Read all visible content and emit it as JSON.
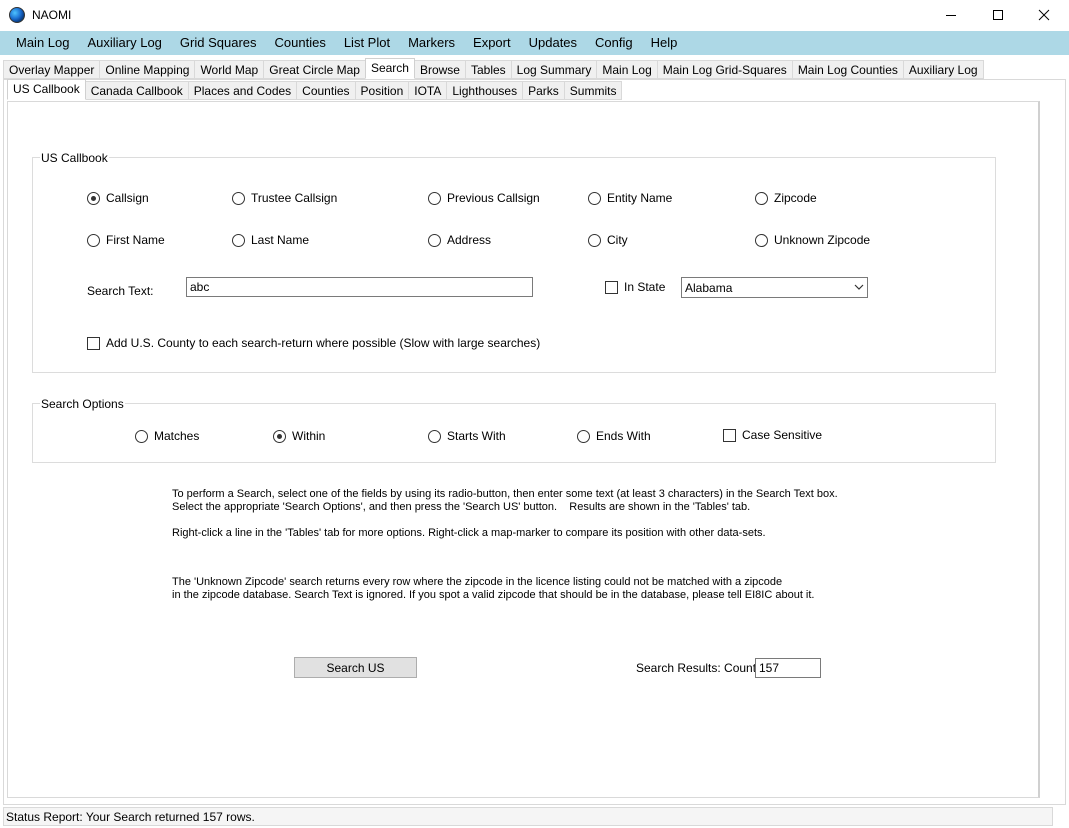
{
  "window": {
    "title": "NAOMI",
    "minimize_glyph": "—",
    "close_glyph": "✕"
  },
  "menu": [
    "Main Log",
    "Auxiliary Log",
    "Grid Squares",
    "Counties",
    "List Plot",
    "Markers",
    "Export",
    "Updates",
    "Config",
    "Help"
  ],
  "tabs_top": {
    "items": [
      "Overlay Mapper",
      "Online Mapping",
      "World Map",
      "Great Circle Map",
      "Search",
      "Browse",
      "Tables",
      "Log Summary",
      "Main Log",
      "Main Log Grid-Squares",
      "Main Log Counties",
      "Auxiliary Log"
    ],
    "active": "Search"
  },
  "tabs_sub": {
    "items": [
      "US Callbook",
      "Canada Callbook",
      "Places and Codes",
      "Counties",
      "Position",
      "IOTA",
      "Lighthouses",
      "Parks",
      "Summits"
    ],
    "active": "US Callbook"
  },
  "us_callbook": {
    "group_label": "US Callbook",
    "fields": {
      "callsign": "Callsign",
      "trustee_callsign": "Trustee Callsign",
      "previous_callsign": "Previous Callsign",
      "entity_name": "Entity Name",
      "zipcode": "Zipcode",
      "first_name": "First Name",
      "last_name": "Last Name",
      "address": "Address",
      "city": "City",
      "unknown_zipcode": "Unknown Zipcode"
    },
    "selected_field": "Callsign",
    "search_text_label": "Search Text:",
    "search_text_value": "abc",
    "in_state_label": "In State",
    "in_state_checked": false,
    "state_selected": "Alabama",
    "county_checkbox_label": "Add U.S. County to each search-return where possible (Slow with large searches)",
    "county_checked": false
  },
  "search_options": {
    "group_label": "Search Options",
    "matches": "Matches",
    "within": "Within",
    "starts_with": "Starts With",
    "ends_with": "Ends With",
    "selected": "Within",
    "case_sensitive_label": "Case Sensitive",
    "case_sensitive_checked": false
  },
  "instructions": {
    "line1": "To perform a Search, select one of the fields by using its radio-button, then enter some text (at least 3 characters) in the Search Text box.",
    "line2": "Select the appropriate 'Search Options', and then press the 'Search US' button.    Results are shown in the 'Tables' tab.",
    "line3": "Right-click a line in the 'Tables' tab for more options. Right-click a map-marker to compare its position with other data-sets.",
    "line4": "The 'Unknown Zipcode' search returns every row where the zipcode in the licence listing could not be matched with a zipcode",
    "line5": "in the zipcode database. Search Text is ignored. If you spot a valid zipcode that should be in the database, please tell EI8IC about it."
  },
  "search_button_label": "Search US",
  "results": {
    "label": "Search Results:  Count",
    "count": "157"
  },
  "status": {
    "text": "Status Report: Your Search returned 157 rows."
  }
}
